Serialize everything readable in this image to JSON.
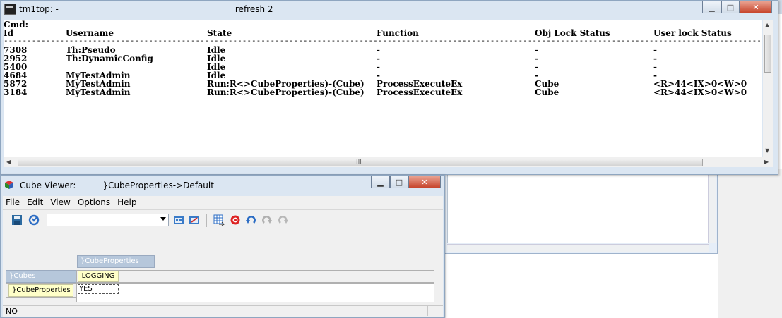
{
  "tm1top": {
    "title": "tm1top: -",
    "title_suffix": "refresh 2",
    "cmd_label": "Cmd:",
    "columns": [
      "Id",
      "Username",
      "State",
      "Function",
      "Obj Lock Status",
      "User lock Status"
    ],
    "separator": "--------------------------------------------------------------------------------------------------------------------------------------------------------------------------",
    "rows": [
      [
        "7308",
        "Th:Pseudo",
        "Idle",
        "-",
        "-",
        "-"
      ],
      [
        "2952",
        "Th:DynamicConfig",
        "Idle",
        "-",
        "-",
        "-"
      ],
      [
        "5400",
        "",
        "Idle",
        "-",
        "-",
        "-"
      ],
      [
        "4684",
        "MyTestAdmin",
        "Idle",
        "-",
        "-",
        "-"
      ],
      [
        "5872",
        "MyTestAdmin",
        "Run:R<>CubeProperties)-(Cube)",
        "ProcessExecuteEx",
        "Cube",
        "<R>44<IX>0<W>0"
      ],
      [
        "3184",
        "MyTestAdmin",
        "Run:R<>CubeProperties)-(Cube)",
        "ProcessExecuteEx",
        "Cube",
        "<R>44<IX>0<W>0"
      ]
    ],
    "hscroll_grip": "III"
  },
  "cube_viewer": {
    "title_prefix": "Cube Viewer:",
    "title_suffix": "}CubeProperties->Default",
    "menu": [
      "File",
      "Edit",
      "View",
      "Options",
      "Help"
    ],
    "column_dimension": "}CubeProperties",
    "title_dimension": "}Cubes",
    "column_element": "LOGGING",
    "row_element": "}CubeProperties",
    "cell_value": "YES",
    "status": "NO"
  },
  "colors": {
    "titlebar": "#dbe6f2",
    "dim_header": "#b6c7db",
    "element_bg": "#ffffc8",
    "close_button": "#c7452d"
  }
}
